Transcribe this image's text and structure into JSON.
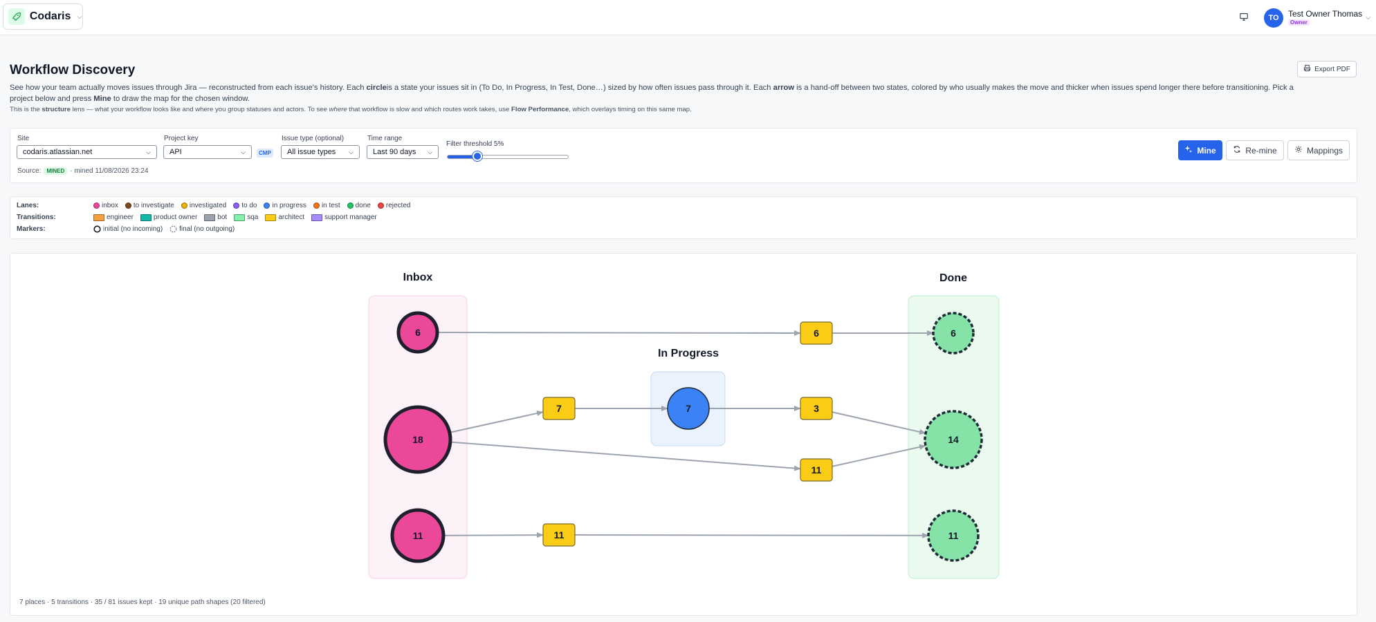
{
  "app": {
    "name": "Codaris"
  },
  "user": {
    "name": "Test Owner Thomas",
    "initials": "TO",
    "role": "Owner"
  },
  "header": {
    "title": "Workflow Discovery",
    "desc_1": "See how your team actually moves issues through Jira — reconstructed from each issue's history. Each ",
    "desc_circle": "circle",
    "desc_2": "is a state your issues sit in (To Do, In Progress, In Test, Done…) sized by how often issues pass through it. Each ",
    "desc_arrow": "arrow",
    "desc_3": " is a hand-off between two states, colored by who usually makes the move and thicker when issues spend longer there before transitioning. Pick a project below and press ",
    "desc_mine": "Mine",
    "desc_4": " to draw the map for the chosen window.",
    "sub_1": "This is the ",
    "sub_structure": "structure",
    "sub_2": " lens — what your workflow looks like and where you group statuses and actors. To see ",
    "sub_where": "where",
    "sub_3": " that workflow is slow and which routes work takes, use ",
    "sub_flow": "Flow Performance",
    "sub_4": ", which overlays timing on this same map.",
    "export_label": "Export PDF"
  },
  "controls": {
    "site_label": "Site",
    "site_value": "codaris.atlassian.net",
    "project_label": "Project key",
    "project_value": "API",
    "project_badge": "CMP",
    "issue_type_label": "Issue type (optional)",
    "issue_type_value": "All issue types",
    "time_range_label": "Time range",
    "time_range_value": "Last 90 days",
    "filter_label": "Filter threshold 5%",
    "filter_value_pct": 5,
    "filter_max_pct": 20,
    "source_label": "Source:",
    "source_badge": "MINED",
    "source_mined": "· mined 11/08/2026 23:24",
    "mine_label": "Mine",
    "remine_label": "Re-mine",
    "mappings_label": "Mappings"
  },
  "legend": {
    "lanes_title": "Lanes:",
    "lanes": [
      {
        "label": "inbox",
        "color": "#ec4899"
      },
      {
        "label": "to investigate",
        "color": "#7c4a1e"
      },
      {
        "label": "investigated",
        "color": "#eab308"
      },
      {
        "label": "to do",
        "color": "#8b5cf6"
      },
      {
        "label": "in progress",
        "color": "#3b82f6"
      },
      {
        "label": "in test",
        "color": "#f97316"
      },
      {
        "label": "done",
        "color": "#22c55e"
      },
      {
        "label": "rejected",
        "color": "#ef4444"
      }
    ],
    "transitions_title": "Transitions:",
    "transitions": [
      {
        "label": "engineer",
        "color": "#f59e42"
      },
      {
        "label": "product owner",
        "color": "#14b8a6"
      },
      {
        "label": "bot",
        "color": "#9ca3af"
      },
      {
        "label": "sqa",
        "color": "#86efac"
      },
      {
        "label": "architect",
        "color": "#facc15"
      },
      {
        "label": "support manager",
        "color": "#a78bfa"
      }
    ],
    "markers_title": "Markers:",
    "marker_initial": "initial (no incoming)",
    "marker_final": "final (no outgoing)"
  },
  "map": {
    "lanes": [
      {
        "id": "inbox",
        "label": "Inbox"
      },
      {
        "id": "inprogress",
        "label": "In Progress"
      },
      {
        "id": "done",
        "label": "Done"
      }
    ],
    "places": [
      {
        "id": "p1",
        "lane": "inbox",
        "count": "6",
        "kind": "initial"
      },
      {
        "id": "p2",
        "lane": "inbox",
        "count": "18",
        "kind": "initial"
      },
      {
        "id": "p3",
        "lane": "inbox",
        "count": "11",
        "kind": "initial"
      },
      {
        "id": "p4",
        "lane": "inprogress",
        "count": "7",
        "kind": "normal"
      },
      {
        "id": "p5",
        "lane": "done",
        "count": "6",
        "kind": "final"
      },
      {
        "id": "p6",
        "lane": "done",
        "count": "14",
        "kind": "final"
      },
      {
        "id": "p7",
        "lane": "done",
        "count": "11",
        "kind": "final"
      }
    ],
    "transitions": [
      {
        "id": "t1",
        "count": "6",
        "actor": "architect"
      },
      {
        "id": "t2",
        "count": "7",
        "actor": "architect"
      },
      {
        "id": "t3",
        "count": "3",
        "actor": "architect"
      },
      {
        "id": "t4",
        "count": "11",
        "actor": "architect"
      },
      {
        "id": "t5",
        "count": "11",
        "actor": "architect"
      }
    ],
    "edges": [
      [
        "p1",
        "t1"
      ],
      [
        "t1",
        "p5"
      ],
      [
        "p2",
        "t2"
      ],
      [
        "t2",
        "p4"
      ],
      [
        "p4",
        "t3"
      ],
      [
        "t3",
        "p6"
      ],
      [
        "p2",
        "t4"
      ],
      [
        "t4",
        "p6"
      ],
      [
        "p3",
        "t5"
      ],
      [
        "t5",
        "p7"
      ]
    ]
  },
  "footer": {
    "stats": "7 places · 5 transitions · 35 / 81 issues kept · 19 unique path shapes (20 filtered)"
  }
}
